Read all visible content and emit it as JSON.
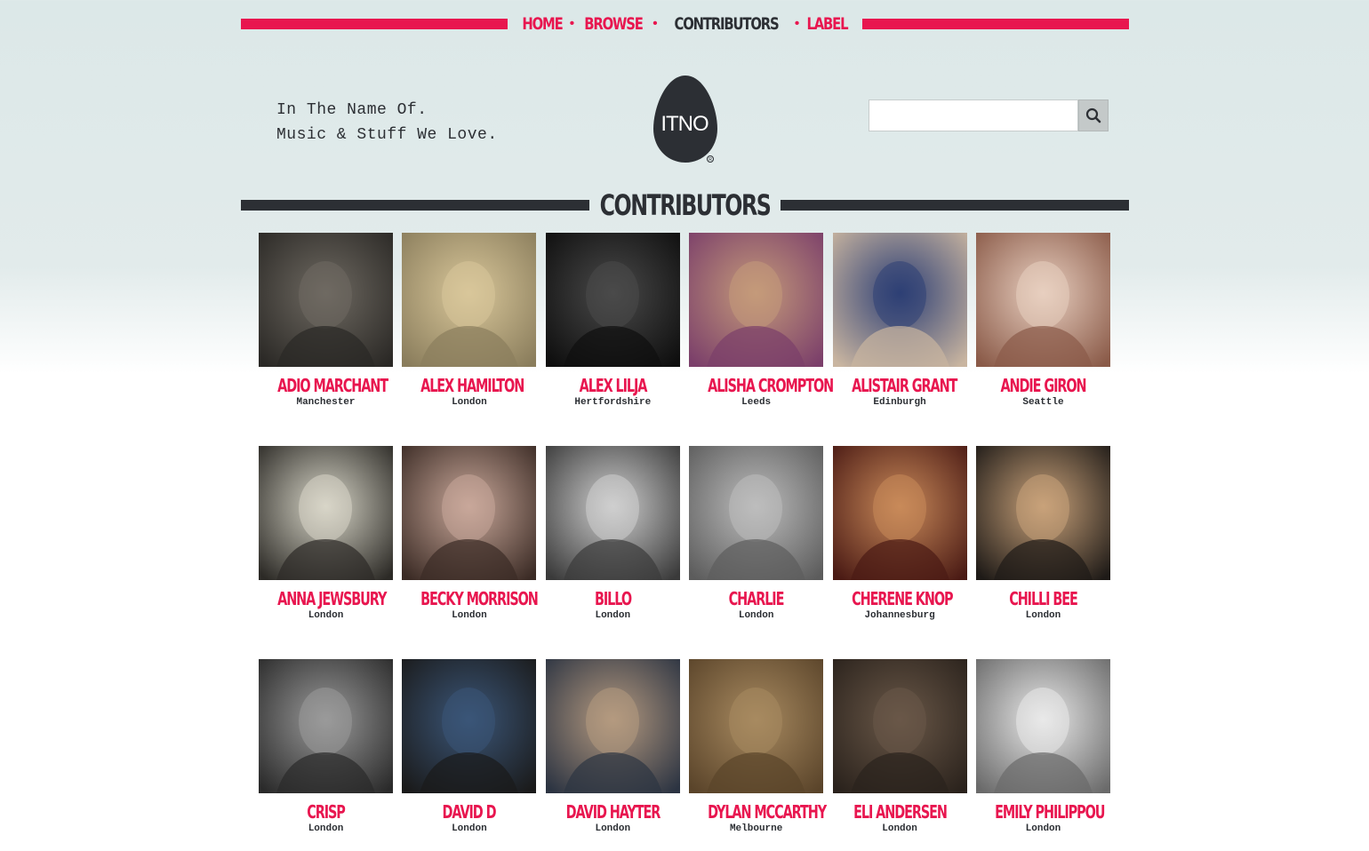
{
  "nav": {
    "items": [
      {
        "label": "HOME",
        "active": false
      },
      {
        "label": "BROWSE",
        "active": false
      },
      {
        "label": "CONTRIBUTORS",
        "active": true
      },
      {
        "label": "LABEL",
        "active": false
      }
    ]
  },
  "header": {
    "tagline_line1": "In The Name Of.",
    "tagline_line2": "Music & Stuff We Love.",
    "logo_text": "ITNO",
    "search_placeholder": "",
    "search_value": ""
  },
  "section": {
    "title": "CONTRIBUTORS"
  },
  "contributors": [
    {
      "name": "ADIO MARCHANT",
      "city": "Manchester",
      "tone": [
        "#6f6a62",
        "#2a2825"
      ]
    },
    {
      "name": "ALEX HAMILTON",
      "city": "London",
      "tone": [
        "#d9c79a",
        "#8a7d5c"
      ]
    },
    {
      "name": "ALEX LILJA",
      "city": "Hertfordshire",
      "tone": [
        "#4a4a4a",
        "#0e0e0e"
      ]
    },
    {
      "name": "ALISHA CROMPTON",
      "city": "Leeds",
      "tone": [
        "#c49a7a",
        "#7b3f6a"
      ]
    },
    {
      "name": "ALISTAIR GRANT",
      "city": "Edinburgh",
      "tone": [
        "#2d3f75",
        "#c9b5a0"
      ]
    },
    {
      "name": "ANDIE GIRON",
      "city": "Seattle",
      "tone": [
        "#e8cfc0",
        "#8a5a48"
      ]
    },
    {
      "name": "ANNA JEWSBURY",
      "city": "London",
      "tone": [
        "#d8d6c8",
        "#2c2a26"
      ]
    },
    {
      "name": "BECKY MORRISON",
      "city": "London",
      "tone": [
        "#c9a89a",
        "#3b2b25"
      ]
    },
    {
      "name": "BILLO",
      "city": "London",
      "tone": [
        "#cfcfcf",
        "#3a3a3a"
      ]
    },
    {
      "name": "CHARLIE",
      "city": "London",
      "tone": [
        "#bdbdbd",
        "#5c5c5c"
      ]
    },
    {
      "name": "CHERENE KNOP",
      "city": "Johannesburg",
      "tone": [
        "#c98a5a",
        "#4a1a14"
      ]
    },
    {
      "name": "CHILLI BEE",
      "city": "London",
      "tone": [
        "#c9a27a",
        "#1e1a17"
      ]
    },
    {
      "name": "CRISP",
      "city": "London",
      "tone": [
        "#9a9a9a",
        "#2a2a2a"
      ]
    },
    {
      "name": "DAVID D",
      "city": "London",
      "tone": [
        "#3b5678",
        "#1a1a1a"
      ]
    },
    {
      "name": "DAVID HAYTER",
      "city": "London",
      "tone": [
        "#b59a80",
        "#2c3442"
      ]
    },
    {
      "name": "DYLAN MCCARTHY",
      "city": "Melbourne",
      "tone": [
        "#a88a60",
        "#5a442a"
      ]
    },
    {
      "name": "ELI ANDERSEN",
      "city": "London",
      "tone": [
        "#6a5848",
        "#2a221c"
      ]
    },
    {
      "name": "EMILY PHILIPPOU",
      "city": "London",
      "tone": [
        "#e9e9e9",
        "#6a6a6a"
      ]
    }
  ]
}
